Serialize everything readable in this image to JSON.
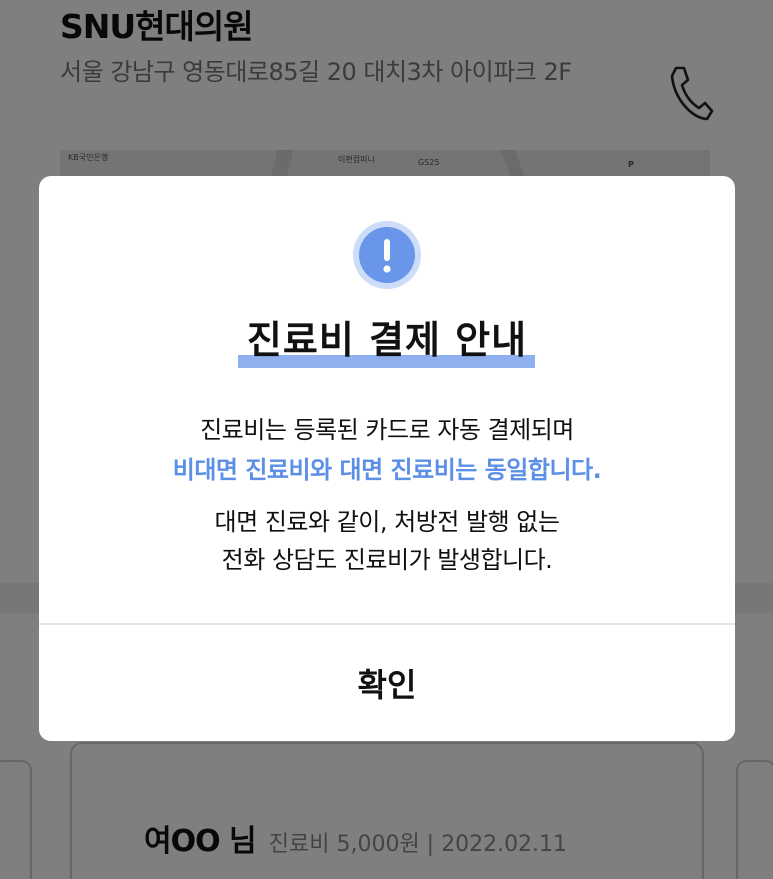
{
  "clinic": {
    "name": "SNU현대의원",
    "address": "서울 강남구 영동대로85길 20 대치3차 아이파크 2F",
    "phone_icon": "phone-icon"
  },
  "map": {
    "labels": [
      "KB국민은행",
      "이편컴퍼니",
      "GS25",
      "P"
    ]
  },
  "record": {
    "patient": "여OO 님",
    "meta": "진료비 5,000원 | 2022.02.11"
  },
  "modal": {
    "icon": "alert-icon",
    "title": "진료비 결제 안내",
    "line1": "진료비는 등록된 카드로 자동 결제되며",
    "line2": "비대면 진료비와 대면 진료비는 동일합니다.",
    "line3": "대면 진료와 같이, 처방전 발행 없는",
    "line4": "전화 상담도 진료비가 발생합니다.",
    "confirm_label": "확인"
  },
  "colors": {
    "accent": "#5c8fe6",
    "highlight": "#8fb0ef",
    "icon_fill": "#6a96ea",
    "icon_ring": "#cddcf8"
  }
}
